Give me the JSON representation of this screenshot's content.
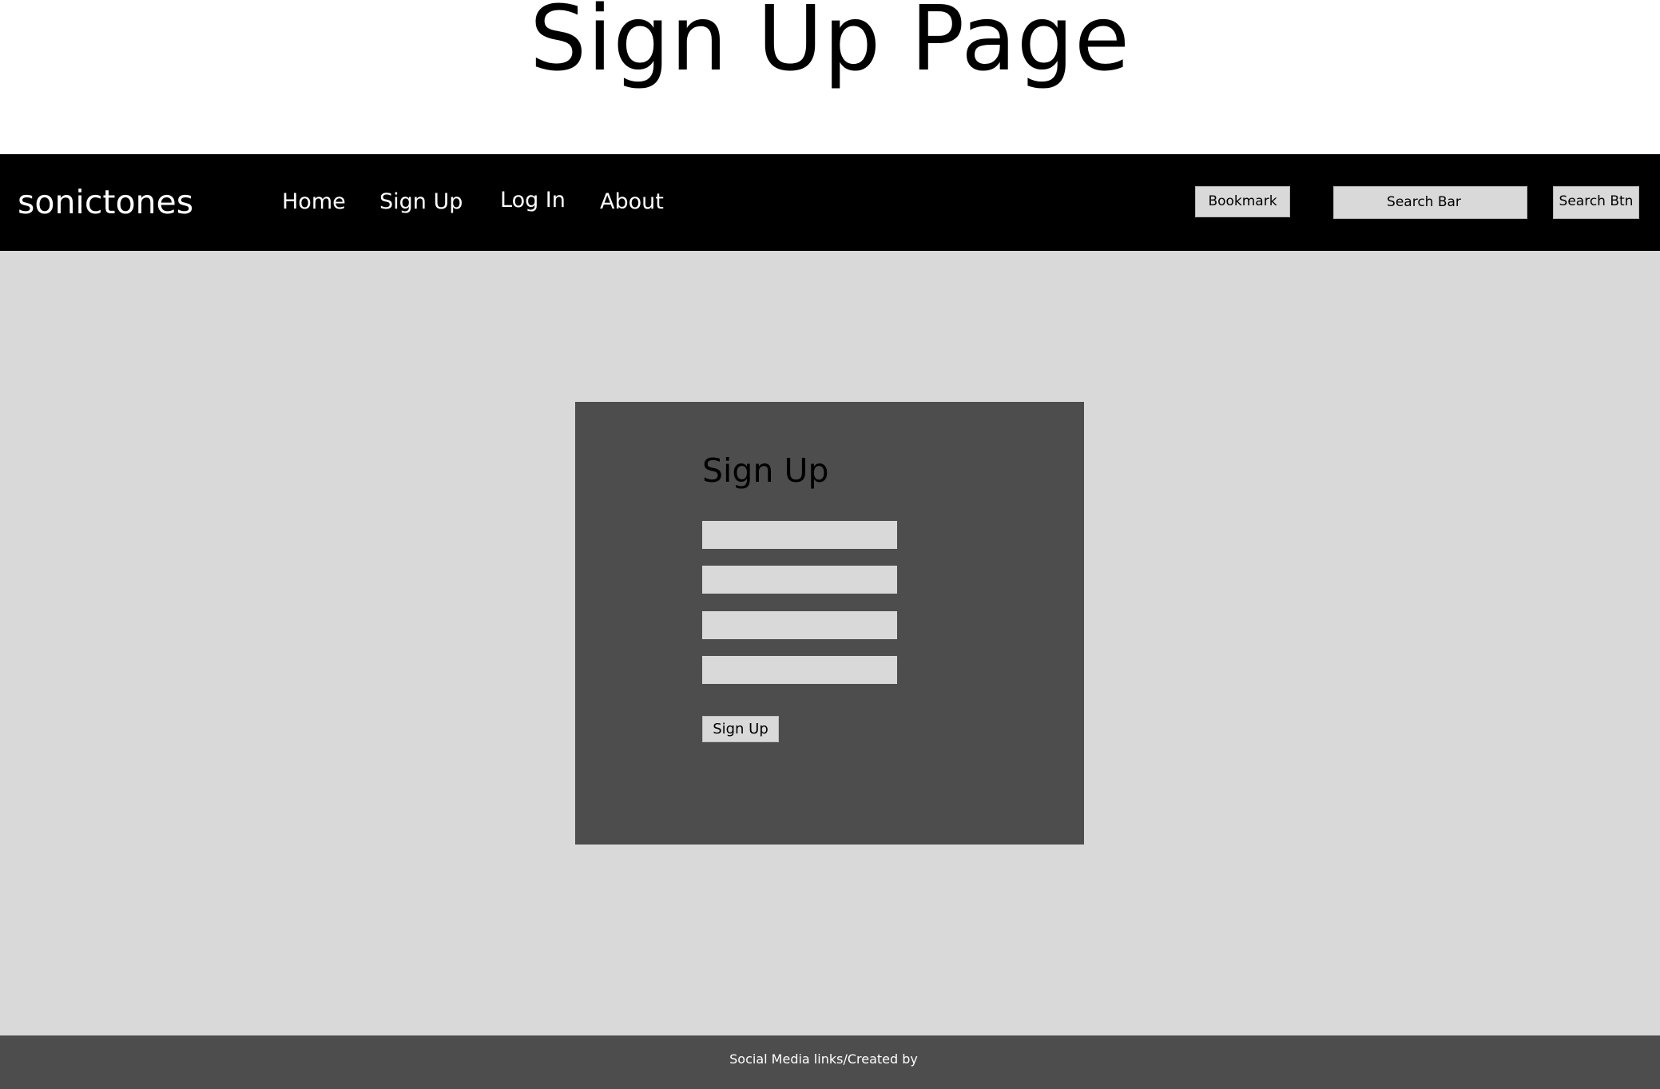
{
  "page": {
    "heading": "Sign Up Page"
  },
  "navbar": {
    "brand": "sonictones",
    "links": [
      {
        "label": "Home"
      },
      {
        "label": "Sign Up"
      },
      {
        "label": "Log In"
      },
      {
        "label": "About"
      }
    ],
    "bookmark_label": "Bookmark",
    "search_bar_label": "Search Bar",
    "search_button_label": "Search Btn"
  },
  "signup_form": {
    "title": "Sign Up",
    "fields": [
      {
        "value": "",
        "placeholder": ""
      },
      {
        "value": "",
        "placeholder": ""
      },
      {
        "value": "",
        "placeholder": ""
      },
      {
        "value": "",
        "placeholder": ""
      }
    ],
    "submit_label": "Sign Up"
  },
  "footer": {
    "text": "Social Media links/Created by"
  },
  "colors": {
    "navbar_background": "#000000",
    "main_background": "#d9d9d9",
    "card_background": "#4d4d4d",
    "footer_background": "#4d4d4d",
    "control_background": "#d9d9d9"
  }
}
